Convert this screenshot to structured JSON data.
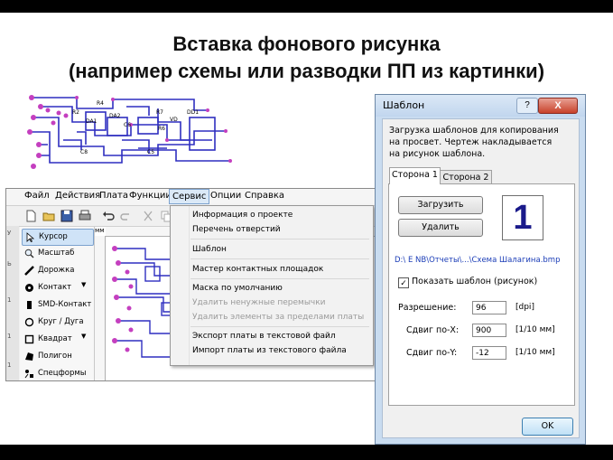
{
  "slide": {
    "title_line1": "Вставка фонового рисунка",
    "title_line2": "(например схемы или разводки ПП из картинки)"
  },
  "pcb_labels": [
    "R4",
    "R2",
    "DA1",
    "C6",
    "DA2",
    "R7",
    "VD",
    "DD1",
    "C5",
    "C8",
    "R6"
  ],
  "app": {
    "menu": [
      "Файл",
      "Действия",
      "Плата",
      "Функции",
      "Сервис",
      "Опции",
      "Справка"
    ],
    "active_menu": "Сервис",
    "ruler_unit": "мм",
    "left_strip_numbers": [
      "У",
      "Ь",
      "1",
      "1",
      "1"
    ],
    "tools": [
      {
        "label": "Курсор",
        "icon": "cursor-icon",
        "selected": true
      },
      {
        "label": "Масштаб",
        "icon": "zoom-icon"
      },
      {
        "label": "Дорожка",
        "icon": "track-icon"
      },
      {
        "label": "Контакт",
        "icon": "pad-icon",
        "has_menu": true
      },
      {
        "label": "SMD-Контакт",
        "icon": "smd-pad-icon"
      },
      {
        "label": "Круг / Дуга",
        "icon": "circle-icon"
      },
      {
        "label": "Квадрат",
        "icon": "square-icon",
        "has_menu": true
      },
      {
        "label": "Полигон",
        "icon": "polygon-icon"
      },
      {
        "label": "Спецформы",
        "icon": "special-shapes-icon"
      }
    ],
    "dropdown": [
      {
        "label": "Информация о проекте"
      },
      {
        "label": "Перечень отверстий"
      },
      {
        "separator": true
      },
      {
        "label": "Шаблон"
      },
      {
        "separator": true
      },
      {
        "label": "Мастер контактных площадок"
      },
      {
        "separator": true
      },
      {
        "label": "Маска по умолчанию"
      },
      {
        "label": "Удалить ненужные перемычки",
        "disabled": true
      },
      {
        "label": "Удалить элементы за пределами платы",
        "disabled": true
      },
      {
        "separator": true
      },
      {
        "label": "Экспорт платы в текстовой файл"
      },
      {
        "label": "Импорт платы из текстового файла"
      }
    ]
  },
  "dialog": {
    "title": "Шаблон",
    "help": "?",
    "close": "X",
    "description": "Загрузка шаблонов для копирования\nна просвет. Чертеж накладывается\nна рисунок шаблона.",
    "tabs": [
      "Сторона 1",
      "Сторона 2"
    ],
    "active_tab": "Сторона 1",
    "load_button": "Загрузить",
    "delete_button": "Удалить",
    "preview_number": "1",
    "file_path": "D:\\ E NB\\Отчеты\\...\\Схема Шалагина.bmp",
    "show_template_label": "Показать шаблон (рисунок)",
    "show_template_checked": true,
    "fields": [
      {
        "label": "Разрешение:",
        "value": "96",
        "unit": "[dpi]"
      },
      {
        "label": "Сдвиг по-X:",
        "value": "900",
        "unit": "[1/10 мм]"
      },
      {
        "label": "Сдвиг по-Y:",
        "value": "-12",
        "unit": "[1/10 мм]"
      }
    ],
    "ok_button": "OK"
  },
  "colors": {
    "board": "#2f2fc0",
    "pads": "#c43fbf",
    "highlight": "#cfe3f7",
    "window_frame": "#c9dcf0",
    "path_text": "#1b3db7"
  }
}
